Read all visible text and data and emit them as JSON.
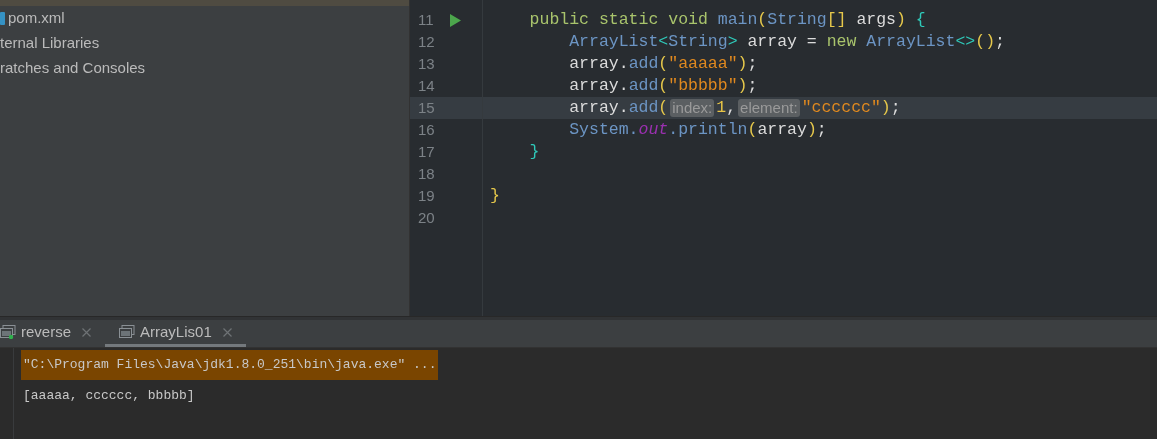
{
  "project_tree": {
    "items": [
      {
        "label": "pom.xml",
        "kind": "maven-file"
      },
      {
        "label": "ternal Libraries",
        "kind": "plain"
      },
      {
        "label": "ratches and Consoles",
        "kind": "plain"
      }
    ]
  },
  "editor": {
    "lines": [
      {
        "number": "11",
        "runnable": true,
        "current": false,
        "tokens": [
          {
            "text": "    public static void ",
            "kind": "keyword"
          },
          {
            "text": "main",
            "kind": "method"
          },
          {
            "text": "(",
            "kind": "paren"
          },
          {
            "text": "String",
            "kind": "type"
          },
          {
            "text": "[]",
            "kind": "paren"
          },
          {
            "text": " args",
            "kind": "plain"
          },
          {
            "text": ")",
            "kind": "paren"
          },
          {
            "text": " {",
            "kind": "brace"
          }
        ]
      },
      {
        "number": "12",
        "runnable": false,
        "current": false,
        "tokens": [
          {
            "text": "        ArrayList",
            "kind": "type"
          },
          {
            "text": "<",
            "kind": "brace"
          },
          {
            "text": "String",
            "kind": "type"
          },
          {
            "text": ">",
            "kind": "brace"
          },
          {
            "text": " array = ",
            "kind": "plain"
          },
          {
            "text": "new ",
            "kind": "keyword"
          },
          {
            "text": "ArrayList",
            "kind": "type"
          },
          {
            "text": "<>",
            "kind": "brace"
          },
          {
            "text": "()",
            "kind": "paren"
          },
          {
            "text": ";",
            "kind": "plain"
          }
        ]
      },
      {
        "number": "13",
        "runnable": false,
        "current": false,
        "tokens": [
          {
            "text": "        array.",
            "kind": "plain"
          },
          {
            "text": "add",
            "kind": "method"
          },
          {
            "text": "(",
            "kind": "paren"
          },
          {
            "text": "\"aaaaa\"",
            "kind": "string"
          },
          {
            "text": ")",
            "kind": "paren"
          },
          {
            "text": ";",
            "kind": "plain"
          }
        ]
      },
      {
        "number": "14",
        "runnable": false,
        "current": false,
        "tokens": [
          {
            "text": "        array.",
            "kind": "plain"
          },
          {
            "text": "add",
            "kind": "method"
          },
          {
            "text": "(",
            "kind": "paren"
          },
          {
            "text": "\"bbbbb\"",
            "kind": "string"
          },
          {
            "text": ")",
            "kind": "paren"
          },
          {
            "text": ";",
            "kind": "plain"
          }
        ]
      },
      {
        "number": "15",
        "runnable": false,
        "current": true,
        "tokens": [
          {
            "text": "        array.",
            "kind": "plain"
          },
          {
            "text": "add",
            "kind": "method"
          },
          {
            "text": "(",
            "kind": "paren"
          },
          {
            "text": "index:",
            "kind": "hint"
          },
          {
            "text": "1",
            "kind": "number"
          },
          {
            "text": ",",
            "kind": "plain"
          },
          {
            "text": "element:",
            "kind": "hint"
          },
          {
            "text": "\"cccccc\"",
            "kind": "string"
          },
          {
            "text": ")",
            "kind": "paren"
          },
          {
            "text": ";",
            "kind": "plain"
          }
        ]
      },
      {
        "number": "16",
        "runnable": false,
        "current": false,
        "tokens": [
          {
            "text": "        System.",
            "kind": "type"
          },
          {
            "text": "out",
            "kind": "static-field"
          },
          {
            "text": ".println",
            "kind": "method"
          },
          {
            "text": "(",
            "kind": "paren"
          },
          {
            "text": "array",
            "kind": "plain"
          },
          {
            "text": ")",
            "kind": "paren"
          },
          {
            "text": ";",
            "kind": "plain"
          }
        ]
      },
      {
        "number": "17",
        "runnable": false,
        "current": false,
        "tokens": [
          {
            "text": "    }",
            "kind": "brace"
          }
        ]
      },
      {
        "number": "18",
        "runnable": false,
        "current": false
      },
      {
        "number": "19",
        "runnable": false,
        "current": false,
        "tokens": [
          {
            "text": "}",
            "kind": "paren"
          }
        ]
      },
      {
        "number": "20",
        "runnable": false,
        "current": false
      }
    ]
  },
  "run_tabs": [
    {
      "label": "reverse",
      "selected": false,
      "running": true
    },
    {
      "label": "ArrayLis01",
      "selected": true,
      "running": false
    }
  ],
  "console": {
    "lines": [
      {
        "text": "\"C:\\Program Files\\Java\\jdk1.8.0_251\\bin\\java.exe\" ...",
        "kind": "command"
      },
      {
        "text": "[aaaaa, cccccc, bbbbb]",
        "kind": "output"
      }
    ]
  }
}
